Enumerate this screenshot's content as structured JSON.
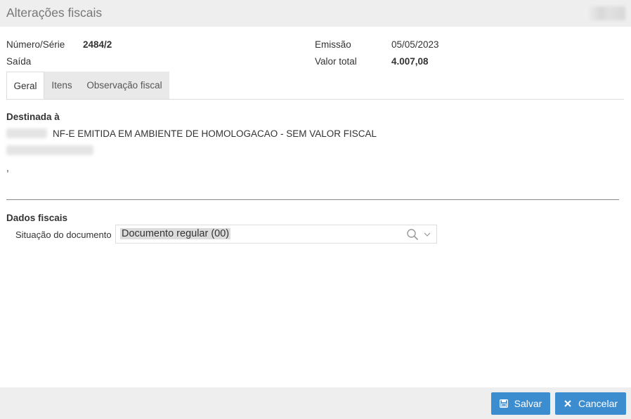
{
  "window": {
    "title": "Alterações fiscais"
  },
  "header": {
    "numero_serie_label": "Número/Série",
    "numero_serie_value": "2484/2",
    "tipo_label": "Saída",
    "emissao_label": "Emissão",
    "emissao_value": "05/05/2023",
    "valor_total_label": "Valor total",
    "valor_total_value": "4.007,08"
  },
  "tabs": [
    {
      "label": "Geral",
      "active": true
    },
    {
      "label": "Itens",
      "active": false
    },
    {
      "label": "Observação fiscal",
      "active": false
    }
  ],
  "destinada": {
    "title": "Destinada à",
    "name": "NF-E EMITIDA EM AMBIENTE DE HOMOLOGACAO - SEM VALOR FISCAL",
    "comma": ","
  },
  "dados_fiscais": {
    "title": "Dados fiscais",
    "situacao_label": "Situação do documento",
    "situacao_value": "Documento regular (00)"
  },
  "footer": {
    "save_label": "Salvar",
    "cancel_label": "Cancelar"
  },
  "icons": {
    "save": "floppy-disk-icon",
    "cancel": "close-icon",
    "search": "search-icon",
    "dropdown": "chevron-down-icon"
  },
  "colors": {
    "primary_button": "#3c8dcf",
    "titlebar_bg": "#eeeeee"
  }
}
